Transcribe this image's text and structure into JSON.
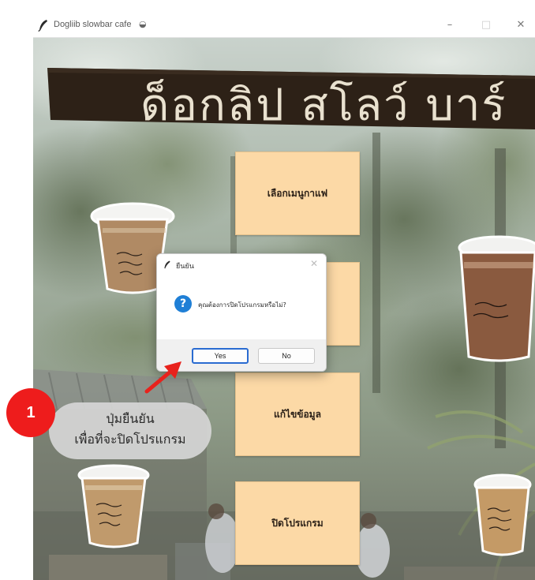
{
  "window": {
    "title": "Dogliib slowbar cafe",
    "controls": {
      "minimize": "–",
      "maximize": "□",
      "close": "✕"
    }
  },
  "banner": {
    "text": "ด็อกลิป สโลว์ บาร์"
  },
  "menu": {
    "buttons": [
      {
        "label": "เลือกเมนูกาแฟ"
      },
      {
        "label": ""
      },
      {
        "label": "แก้ไขข้อมูล"
      },
      {
        "label": "ปิดโปรแกรม"
      }
    ]
  },
  "dialog": {
    "title": "ยืนยัน",
    "close": "✕",
    "icon": "question-icon",
    "icon_glyph": "?",
    "message": "คุณต้องการปิดโปรแกรมหรือไม่?",
    "yes_label": "Yes",
    "no_label": "No"
  },
  "annotation": {
    "step": "1",
    "line1": "ปุ่มยืนยัน",
    "line2": "เพื่อที่จะปิดโปรแกรม"
  },
  "colors": {
    "menu_button": "#fcd9a6",
    "badge": "#ee1c1c",
    "question_icon": "#1f7fd6",
    "yes_focus": "#2a6bd1",
    "arrow": "#e8221c"
  }
}
